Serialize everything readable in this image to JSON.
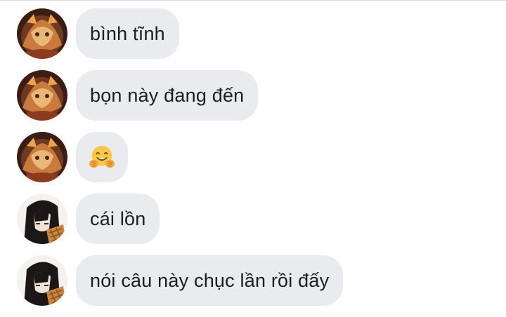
{
  "messages": [
    {
      "sender": "user-a",
      "text": "bình tĩnh"
    },
    {
      "sender": "user-a",
      "text": "bọn này đang đến"
    },
    {
      "sender": "user-a",
      "emoji": "hugging-face"
    },
    {
      "sender": "user-b",
      "text": "cái lồn"
    },
    {
      "sender": "user-b",
      "text": "nói câu này chục lần rồi đấy"
    }
  ],
  "colors": {
    "bubble": "#e9ebee",
    "text": "#1c1e21",
    "emoji": "#f7c948"
  }
}
